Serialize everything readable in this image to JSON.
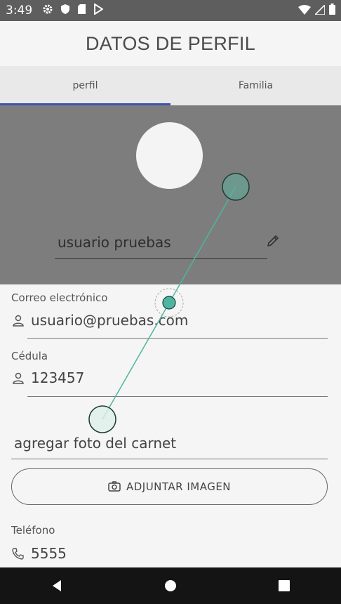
{
  "status": {
    "time": "3:49"
  },
  "header": {
    "title": "DATOS DE PERFIL"
  },
  "tabs": [
    {
      "label": "perfil",
      "active": true
    },
    {
      "label": "Familia",
      "active": false
    }
  ],
  "profile": {
    "name": "usuario pruebas"
  },
  "email": {
    "label": "Correo electrónico",
    "value": "usuario@pruebas.com"
  },
  "cedula": {
    "label": "Cédula",
    "value": "123457"
  },
  "carnet": {
    "placeholder": "agregar foto del carnet"
  },
  "attach_button": {
    "label": "ADJUNTAR  IMAGEN"
  },
  "phone": {
    "label": "Teléfono",
    "value": "5555"
  },
  "colors": {
    "accent": "#3f51b5",
    "header_bg": "#7d7d7d",
    "gesture": "#4db6a0"
  }
}
